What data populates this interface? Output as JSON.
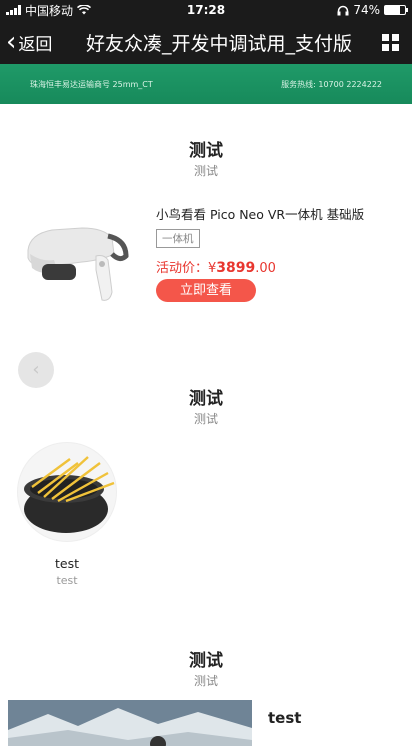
{
  "status_bar": {
    "carrier": "中国移动",
    "time": "17:28",
    "battery": "74%",
    "battery_level": 0.74
  },
  "nav": {
    "back_label": "返回",
    "title": "好友众凑_开发中调试用_支付版"
  },
  "banner": {
    "left_text": "珠海恒丰易达运输商号 25mm_CT",
    "right_text": "服务热线: 10700 2224222"
  },
  "section1": {
    "title": "测试",
    "subtitle": "测试",
    "product": {
      "name": "小鸟看看 Pico Neo VR一体机 基础版",
      "tag": "一体机",
      "price_label": "活动价：",
      "price_symbol": "¥",
      "price_value": "3899",
      "price_decimal": ".00",
      "button_label": "立即查看"
    }
  },
  "section2": {
    "title": "测试",
    "subtitle": "测试",
    "item": {
      "name": "test",
      "subtitle": "test"
    }
  },
  "section3": {
    "title": "测试",
    "subtitle": "测试",
    "item": {
      "label": "test"
    }
  },
  "icons": {
    "back": "chevron-left-icon",
    "grid": "grid-icon",
    "wifi": "wifi-icon",
    "headphones": "headphones-icon",
    "prev": "chevron-left-icon"
  },
  "colors": {
    "nav_bg": "#1b1b1b",
    "banner": "#1f9a68",
    "price": "#e8362f",
    "button": "#f4564a"
  }
}
